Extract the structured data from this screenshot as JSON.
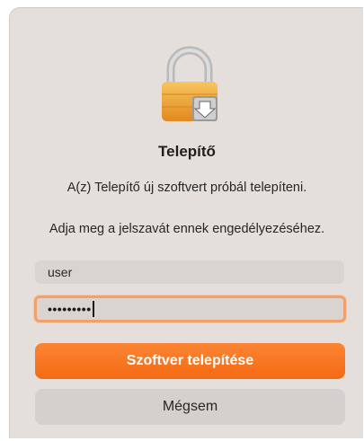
{
  "dialog": {
    "icon": "lock-installer-icon",
    "title": "Telepítő",
    "subtitle": "A(z) Telepítő új szoftvert próbál telepíteni.",
    "prompt": "Adja meg a jelszavát ennek engedélyezéséhez.",
    "username_value": "user",
    "password_masked": "•••••••••",
    "install_label": "Szoftver telepítése",
    "cancel_label": "Mégsem"
  },
  "colors": {
    "background": "#e4dfdb",
    "accent": "#f56a14",
    "focus_ring": "#f0a06a"
  }
}
